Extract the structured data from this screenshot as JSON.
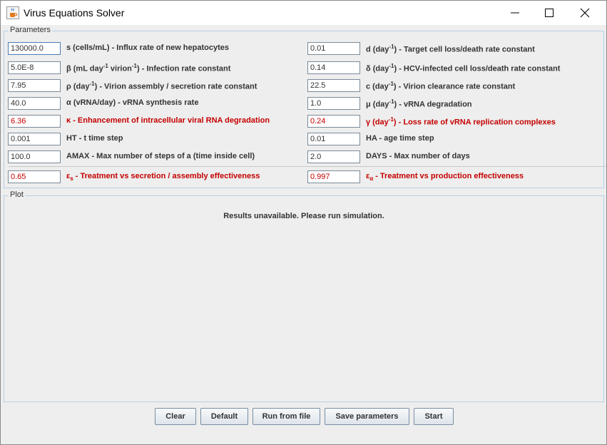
{
  "window": {
    "title": "Virus Equations Solver"
  },
  "parameters": {
    "title": "Parameters",
    "left": [
      {
        "value": "130000.0",
        "label_pre": "s (cells/mL) - Influx rate of new hepatocytes"
      },
      {
        "value": "5.0E-8",
        "label_pre": "β (mL day",
        "sup": "-1",
        "label_mid": " virion",
        "sup2": "-1",
        "label_post": ") - Infection rate constant"
      },
      {
        "value": "7.95",
        "label_pre": "ρ (day",
        "sup": "-1",
        "label_post": ") - Virion assembly / secretion rate constant"
      },
      {
        "value": "40.0",
        "label_pre": "α (vRNA/day) - vRNA synthesis rate"
      },
      {
        "value": "6.36",
        "label_pre": "κ - Enhancement of intracellular viral RNA degradation"
      },
      {
        "value": "0.001",
        "label_pre": "HT - t time step"
      },
      {
        "value": "100.0",
        "label_pre": "AMAX - Max number of steps of a (time inside cell)"
      },
      {
        "value": "0.65",
        "label_pre": "ε",
        "sub": "s",
        "label_post": " - Treatment vs secretion / assembly effectiveness"
      }
    ],
    "right": [
      {
        "value": "0.01",
        "label_pre": "d (day",
        "sup": "-1",
        "label_post": ") - Target cell loss/death rate constant"
      },
      {
        "value": "0.14",
        "label_pre": "δ (day",
        "sup": "-1",
        "label_post": ") - HCV-infected cell loss/death rate constant"
      },
      {
        "value": "22.5",
        "label_pre": "c (day",
        "sup": "-1",
        "label_post": ") - Virion clearance rate constant"
      },
      {
        "value": "1.0",
        "label_pre": "μ (day",
        "sup": "-1",
        "label_post": ") - vRNA degradation"
      },
      {
        "value": "0.24",
        "label_pre": "γ (day",
        "sup": "-1",
        "label_post": ") - Loss rate of vRNA replication complexes"
      },
      {
        "value": "0.01",
        "label_pre": "HA - age time step"
      },
      {
        "value": "2.0",
        "label_pre": "DAYS - Max number of days"
      },
      {
        "value": "0.997",
        "label_pre": "ε",
        "sub": "α",
        "label_post": " - Treatment vs production effectiveness"
      }
    ]
  },
  "plot": {
    "title": "Plot",
    "message": "Results unavailable. Please run simulation."
  },
  "buttons": {
    "clear": "Clear",
    "default": "Default",
    "run_from_file": "Run from file",
    "save_parameters": "Save parameters",
    "start": "Start"
  },
  "colors": {
    "highlight": "#c40000",
    "group_border": "#b8cfe5",
    "background": "#eeeeee"
  },
  "icons": {
    "app": "java-cup-icon",
    "minimize": "minimize-icon",
    "maximize": "maximize-icon",
    "close": "close-icon"
  }
}
